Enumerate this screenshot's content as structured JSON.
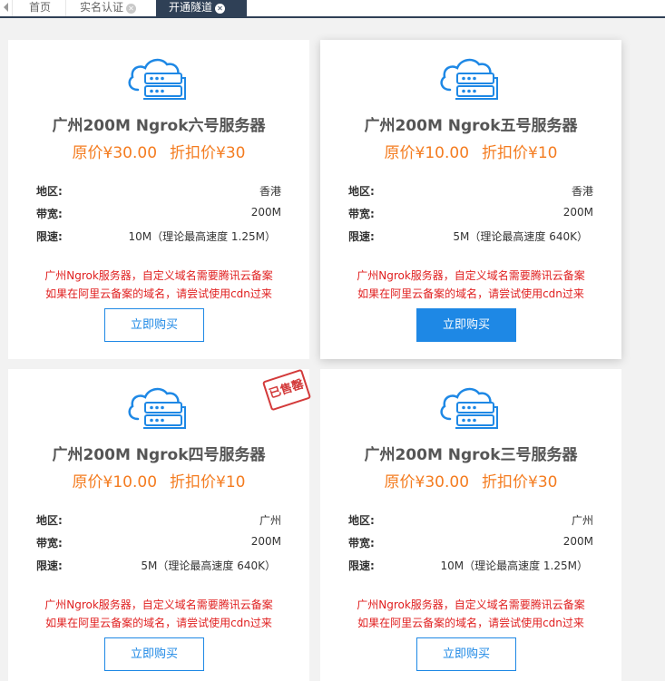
{
  "tabs": [
    {
      "label": "首页"
    },
    {
      "label": "实名认证"
    },
    {
      "label": "开通隧道"
    }
  ],
  "labels": {
    "region": "地区:",
    "bandwidth": "带宽:",
    "speed": "限速:"
  },
  "cards": [
    {
      "title": "广州200M Ngrok六号服务器",
      "original_price": "原价¥30.00",
      "discount_price": "折扣价¥30",
      "region": "香港",
      "bandwidth": "200M",
      "speed": "10M（理论最高速度 1.25M）",
      "note_line1": "广州Ngrok服务器，自定义域名需要腾讯云备案",
      "note_line2": "如果在阿里云备案的域名，请尝试使用cdn过来",
      "buy_label": "立即购买"
    },
    {
      "title": "广州200M Ngrok五号服务器",
      "original_price": "原价¥10.00",
      "discount_price": "折扣价¥10",
      "region": "香港",
      "bandwidth": "200M",
      "speed": "5M（理论最高速度 640K）",
      "note_line1": "广州Ngrok服务器，自定义域名需要腾讯云备案",
      "note_line2": "如果在阿里云备案的域名，请尝试使用cdn过来",
      "buy_label": "立即购买"
    },
    {
      "title": "广州200M Ngrok四号服务器",
      "original_price": "原价¥10.00",
      "discount_price": "折扣价¥10",
      "region": "广州",
      "bandwidth": "200M",
      "speed": "5M（理论最高速度 640K）",
      "note_line1": "广州Ngrok服务器，自定义域名需要腾讯云备案",
      "note_line2": "如果在阿里云备案的域名，请尝试使用cdn过来",
      "buy_label": "立即购买",
      "stamp": "已售罄"
    },
    {
      "title": "广州200M Ngrok三号服务器",
      "original_price": "原价¥30.00",
      "discount_price": "折扣价¥30",
      "region": "广州",
      "bandwidth": "200M",
      "speed": "10M（理论最高速度 1.25M）",
      "note_line1": "广州Ngrok服务器，自定义域名需要腾讯云备案",
      "note_line2": "如果在阿里云备案的域名，请尝试使用cdn过来",
      "buy_label": "立即购买"
    }
  ],
  "colors": {
    "accent": "#1e88e5",
    "price": "#f47c20",
    "note": "#e02020",
    "tab_active": "#2f4056",
    "stamp": "#d33a3a"
  }
}
